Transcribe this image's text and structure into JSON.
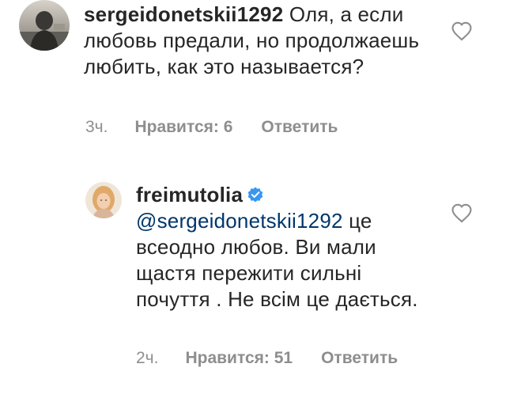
{
  "comments": [
    {
      "username": "sergeidonetskii1292",
      "text": "Оля, а если любовь предали, но продолжаешь любить, как это называется?",
      "time": "3ч.",
      "likes": "Нравится: 6",
      "reply": "Ответить"
    },
    {
      "username": "freimutolia",
      "verified": true,
      "mention": "@sergeidonetskii1292",
      "text": "це всеодно любов. Ви мали щастя пережити сильні почуття . Не всім це дається.",
      "time": "2ч.",
      "likes": "Нравится: 51",
      "reply": "Ответить"
    }
  ],
  "icons": {
    "like": "heart-outline-icon",
    "verified": "verified-badge-icon"
  },
  "colors": {
    "text": "#262626",
    "meta": "#8e8e8e",
    "mention": "#00376b",
    "verified": "#3897f0"
  }
}
